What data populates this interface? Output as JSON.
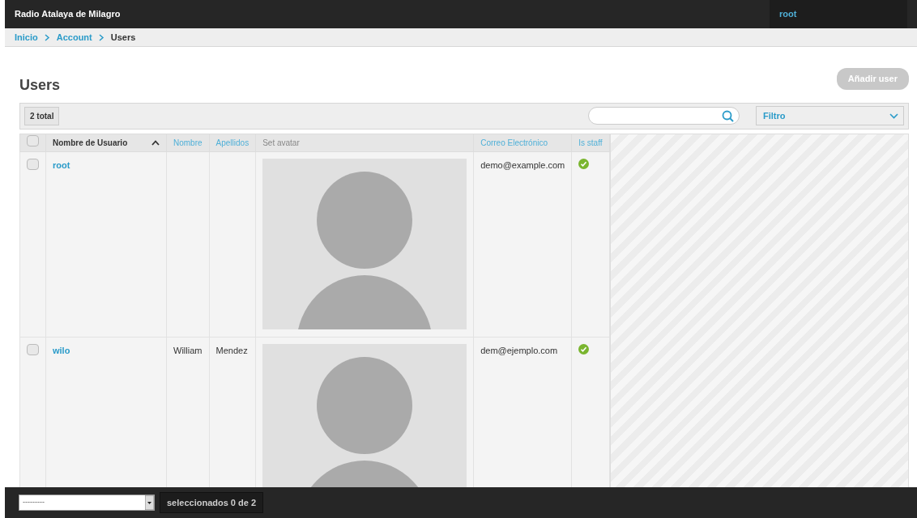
{
  "navbar": {
    "brand": "Radio Atalaya de Milagro",
    "user": "root"
  },
  "breadcrumb": [
    {
      "label": "Inicio",
      "current": false
    },
    {
      "label": "Account",
      "current": false
    },
    {
      "label": "Users",
      "current": true
    }
  ],
  "page_title": "Users",
  "add_button": "Añadir user",
  "toolbar": {
    "total": "2 total",
    "filter": "Filtro"
  },
  "table": {
    "select_all": {
      "checked": false
    },
    "columns": [
      {
        "label": "Nombre de Usuario",
        "sortable": true,
        "sorted": true
      },
      {
        "label": "Nombre",
        "sortable": true,
        "sorted": false
      },
      {
        "label": "Apellidos",
        "sortable": true,
        "sorted": false
      },
      {
        "label": "Set avatar",
        "sortable": false,
        "sorted": false
      },
      {
        "label": "Correo Electrónico",
        "sortable": true,
        "sorted": false
      },
      {
        "label": "Is staff",
        "sortable": true,
        "sorted": false
      }
    ],
    "rows": [
      {
        "checked": false,
        "username": "root",
        "email": "demo@example.com",
        "is_staff": true
      },
      {
        "checked": false,
        "username": "wilo",
        "first_name": "William",
        "last_name": "Mendez",
        "email": "dem@ejemplo.com",
        "is_staff": true
      }
    ]
  },
  "footer": {
    "action": {
      "value": "---------"
    },
    "selected_count": "seleccionados 0 de 2"
  }
}
